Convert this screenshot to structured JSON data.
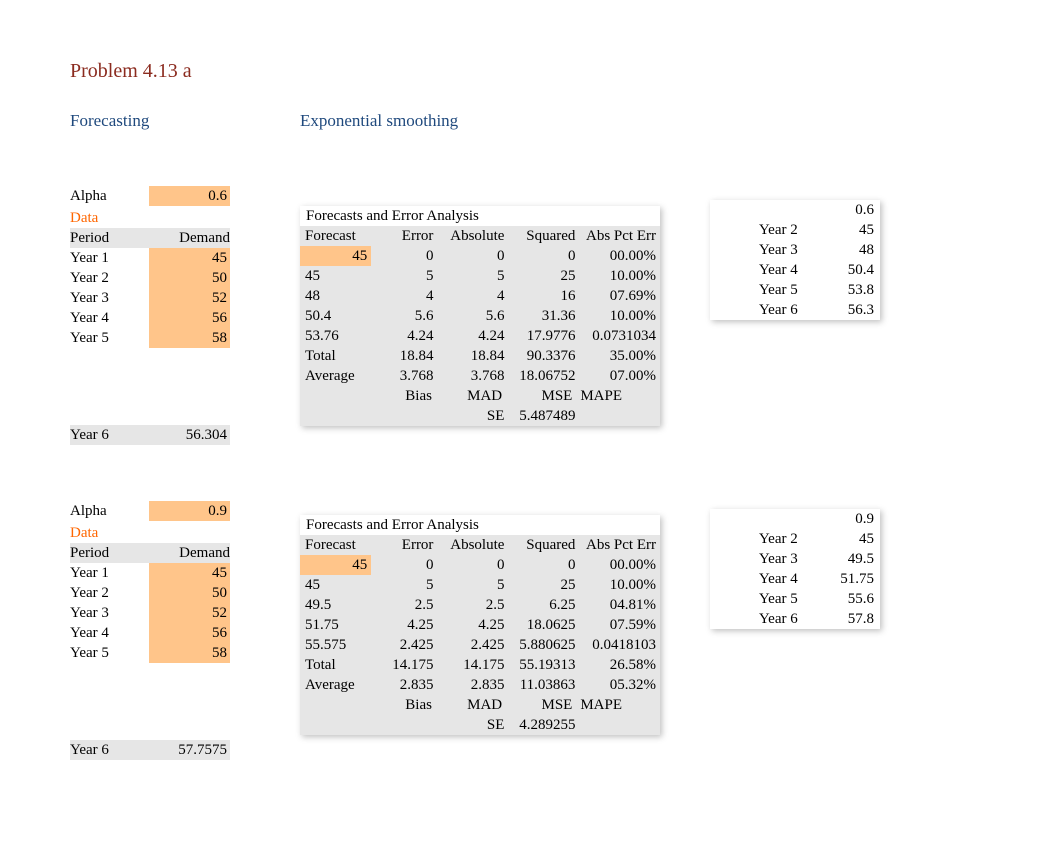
{
  "title": "Problem 4.13 a",
  "subtitle1": "Forecasting",
  "subtitle2": "Exponential smoothing",
  "labels": {
    "alpha": "Alpha",
    "data": "Data",
    "period": "Period",
    "demand": "Demand",
    "forecastsTitle": "Forecasts and Error Analysis",
    "forecast": "Forecast",
    "error": "Error",
    "absolute": "Absolute",
    "squared": "Squared",
    "absPctErr": "Abs Pct Err",
    "total": "Total",
    "average": "Average",
    "bias": "Bias",
    "mad": "MAD",
    "mse": "MSE",
    "mape": "MAPE",
    "se": "SE"
  },
  "sets": [
    {
      "alpha": "0.6",
      "periods": [
        {
          "name": "Year 1",
          "demand": "45"
        },
        {
          "name": "Year 2",
          "demand": "50"
        },
        {
          "name": "Year 3",
          "demand": "52"
        },
        {
          "name": "Year 4",
          "demand": "56"
        },
        {
          "name": "Year 5",
          "demand": "58"
        }
      ],
      "yr6": {
        "name": "Year 6",
        "val": "56.304"
      },
      "rows": [
        {
          "f": "45",
          "e": "0",
          "a": "0",
          "s": "0",
          "p": "00.00%"
        },
        {
          "f": "45",
          "e": "5",
          "a": "5",
          "s": "25",
          "p": "10.00%"
        },
        {
          "f": "48",
          "e": "4",
          "a": "4",
          "s": "16",
          "p": "07.69%"
        },
        {
          "f": "50.4",
          "e": "5.6",
          "a": "5.6",
          "s": "31.36",
          "p": "10.00%"
        },
        {
          "f": "53.76",
          "e": "4.24",
          "a": "4.24",
          "s": "17.9776",
          "p": "0.0731034"
        }
      ],
      "total": {
        "e": "18.84",
        "a": "18.84",
        "s": "90.3376",
        "p": "35.00%"
      },
      "average": {
        "e": "3.768",
        "a": "3.768",
        "s": "18.06752",
        "p": "07.00%"
      },
      "seVal": "5.487489",
      "right": {
        "alpha": "0.6",
        "rows": [
          {
            "y": "Year 2",
            "v": "45"
          },
          {
            "y": "Year 3",
            "v": "48"
          },
          {
            "y": "Year 4",
            "v": "50.4"
          },
          {
            "y": "Year 5",
            "v": "53.8"
          },
          {
            "y": "Year 6",
            "v": "56.3"
          }
        ]
      }
    },
    {
      "alpha": "0.9",
      "periods": [
        {
          "name": "Year 1",
          "demand": "45"
        },
        {
          "name": "Year 2",
          "demand": "50"
        },
        {
          "name": "Year 3",
          "demand": "52"
        },
        {
          "name": "Year 4",
          "demand": "56"
        },
        {
          "name": "Year 5",
          "demand": "58"
        }
      ],
      "yr6": {
        "name": "Year 6",
        "val": "57.7575"
      },
      "rows": [
        {
          "f": "45",
          "e": "0",
          "a": "0",
          "s": "0",
          "p": "00.00%"
        },
        {
          "f": "45",
          "e": "5",
          "a": "5",
          "s": "25",
          "p": "10.00%"
        },
        {
          "f": "49.5",
          "e": "2.5",
          "a": "2.5",
          "s": "6.25",
          "p": "04.81%"
        },
        {
          "f": "51.75",
          "e": "4.25",
          "a": "4.25",
          "s": "18.0625",
          "p": "07.59%"
        },
        {
          "f": "55.575",
          "e": "2.425",
          "a": "2.425",
          "s": "5.880625",
          "p": "0.0418103"
        }
      ],
      "total": {
        "e": "14.175",
        "a": "14.175",
        "s": "55.19313",
        "p": "26.58%"
      },
      "average": {
        "e": "2.835",
        "a": "2.835",
        "s": "11.03863",
        "p": "05.32%"
      },
      "seVal": "4.289255",
      "right": {
        "alpha": "0.9",
        "rows": [
          {
            "y": "Year 2",
            "v": "45"
          },
          {
            "y": "Year 3",
            "v": "49.5"
          },
          {
            "y": "Year 4",
            "v": "51.75"
          },
          {
            "y": "Year 5",
            "v": "55.6"
          },
          {
            "y": "Year 6",
            "v": "57.8"
          }
        ]
      }
    }
  ]
}
